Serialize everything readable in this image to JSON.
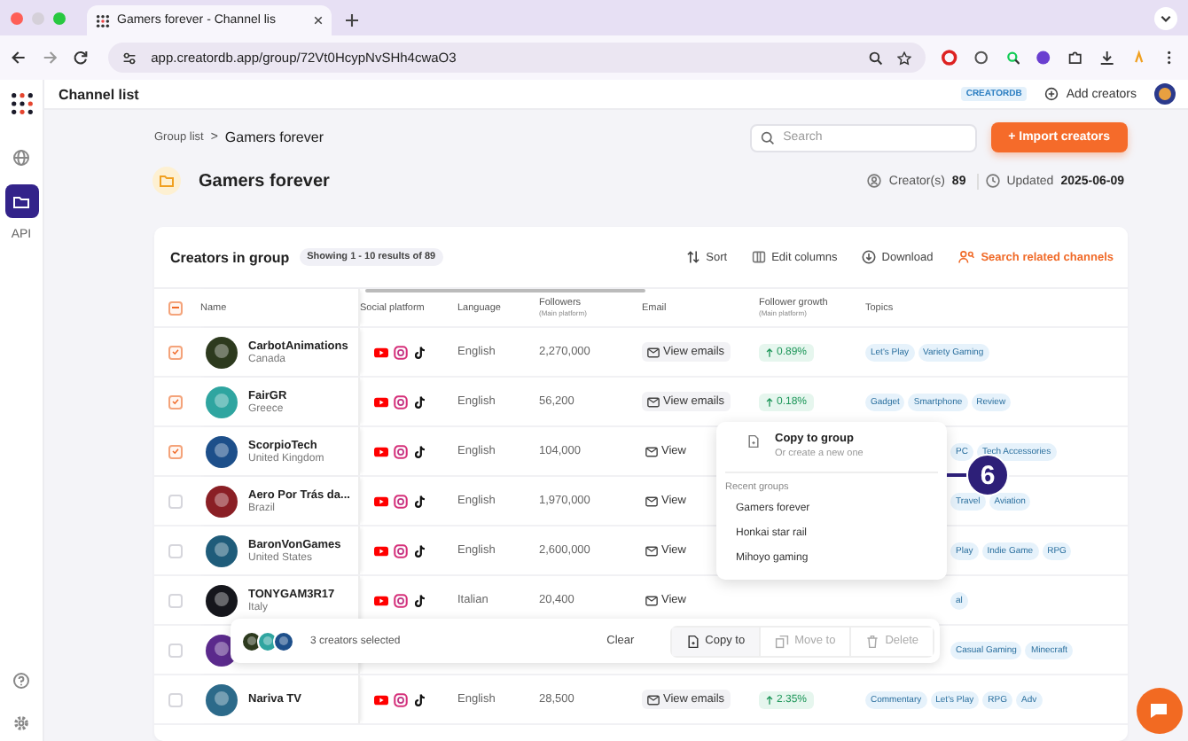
{
  "browser": {
    "tab_title": "Gamers forever - Channel lis",
    "url": "app.creatordb.app/group/72Vt0HcypNvSHh4cwaO3"
  },
  "sidebar": {
    "items": [
      {
        "kind": "globe",
        "selected": false
      },
      {
        "kind": "folder",
        "selected": true
      }
    ],
    "api_label": "API"
  },
  "header": {
    "title": "Channel list",
    "brand_badge": "CREATORDB",
    "add_button": "Add creators"
  },
  "breadcrumb": {
    "parent": "Group list",
    "separator": ">",
    "current": "Gamers forever"
  },
  "search": {
    "placeholder": "Search"
  },
  "import_button": "+ Import creators",
  "group": {
    "title": "Gamers forever",
    "creators_label": "Creator(s)",
    "creators_count": "89",
    "updated_label": "Updated",
    "updated_date": "2025-06-09"
  },
  "table": {
    "title": "Creators in group",
    "showing": "Showing 1 - 10 results of 89",
    "toolbar": [
      {
        "kind": "sort",
        "label": "Sort"
      },
      {
        "kind": "columns",
        "label": "Edit columns"
      },
      {
        "kind": "download",
        "label": "Download"
      },
      {
        "kind": "related",
        "label": "Search related channels"
      }
    ],
    "header_checkbox": {
      "indeterminate": true
    },
    "columns": [
      {
        "label": "Name"
      },
      {
        "label": "Social platform"
      },
      {
        "label": "Language"
      },
      {
        "label": "Followers",
        "sub": "(Main platform)"
      },
      {
        "label": "Email"
      },
      {
        "label": "Follower growth",
        "sub": "(Main platform)"
      },
      {
        "label": "Topics"
      }
    ],
    "rows": [
      {
        "checked": true,
        "name": "CarbotAnimations",
        "country": "Canada",
        "language": "English",
        "followers": "2,270,000",
        "email": "View emails",
        "growth": "0.89%",
        "topics": [
          "Let's Play",
          "Variety Gaming"
        ]
      },
      {
        "checked": true,
        "name": "FairGR",
        "country": "Greece",
        "language": "English",
        "followers": "56,200",
        "email": "View emails",
        "growth": "0.18%",
        "topics": [
          "Gadget",
          "Smartphone",
          "Review"
        ]
      },
      {
        "checked": true,
        "name": "ScorpioTech",
        "country": "United Kingdom",
        "language": "English",
        "followers": "104,000",
        "email": "View",
        "topics": [
          "PC",
          "Tech Accessories"
        ]
      },
      {
        "checked": false,
        "name": "Aero Por Trás da...",
        "country": "Brazil",
        "language": "English",
        "followers": "1,970,000",
        "email": "View",
        "topics": [
          "Travel",
          "Aviation"
        ]
      },
      {
        "checked": false,
        "name": "BaronVonGames",
        "country": "United States",
        "language": "English",
        "followers": "2,600,000",
        "email": "View",
        "topics": [
          "Play",
          "Indie Game",
          "RPG"
        ]
      },
      {
        "checked": false,
        "name": "TONYGAM3R17",
        "country": "Italy",
        "language": "Italian",
        "followers": "20,400",
        "email": "View",
        "topics": [
          "al"
        ]
      },
      {
        "checked": false,
        "topics": [
          "Casual Gaming",
          "Minecraft"
        ]
      },
      {
        "checked": false,
        "name": "Nariva TV",
        "language": "English",
        "followers": "28,500",
        "email": "View emails",
        "growth": "2.35%",
        "topics": [
          "Commentary",
          "Let's Play",
          "RPG",
          "Adv"
        ]
      }
    ]
  },
  "selection_bar": {
    "count_text": "3 creators selected",
    "clear": "Clear",
    "actions": [
      {
        "kind": "copy",
        "label": "Copy to",
        "disabled": false
      },
      {
        "kind": "move",
        "label": "Move to",
        "disabled": true
      },
      {
        "kind": "delete",
        "label": "Delete",
        "disabled": true
      }
    ]
  },
  "popup": {
    "title": "Copy to group",
    "subtitle": "Or create a new one",
    "section": "Recent groups",
    "groups": [
      "Gamers forever",
      "Honkai star rail",
      "Mihoyo gaming"
    ]
  },
  "step_marker": "6"
}
